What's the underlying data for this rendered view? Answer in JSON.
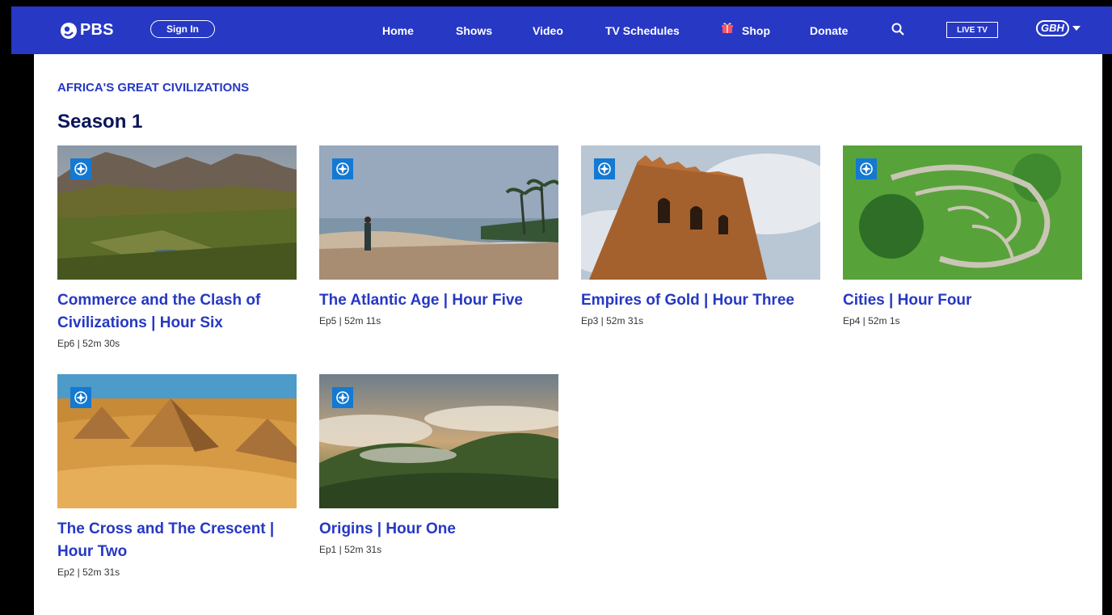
{
  "nav": {
    "logo_text": "PBS",
    "signin_label": "Sign In",
    "items": {
      "home": "Home",
      "shows": "Shows",
      "video": "Video",
      "schedules": "TV Schedules",
      "shop": "Shop",
      "donate": "Donate"
    },
    "live_tv_label": "LIVE TV",
    "station_label": "GBH",
    "icons": [
      "pbs-logo-icon",
      "gift-icon",
      "search-icon",
      "chevron-down-icon"
    ],
    "bar_color": "#2638c4"
  },
  "page": {
    "series_title": "AFRICA'S GREAT CIVILIZATIONS",
    "season_label": "Season 1",
    "link_color": "#2638c4"
  },
  "episodes": [
    {
      "title": "Commerce and the Clash of Civilizations | Hour Six",
      "meta": "Ep6 | 52m 30s"
    },
    {
      "title": "The Atlantic Age | Hour Five",
      "meta": "Ep5 | 52m 11s"
    },
    {
      "title": "Empires of Gold | Hour Three",
      "meta": "Ep3 | 52m 31s"
    },
    {
      "title": "Cities | Hour Four",
      "meta": "Ep4 | 52m 1s"
    },
    {
      "title": "The Cross and The Crescent | Hour Two",
      "meta": "Ep2 | 52m 31s"
    },
    {
      "title": "Origins | Hour One",
      "meta": "Ep1 | 52m 31s"
    }
  ]
}
